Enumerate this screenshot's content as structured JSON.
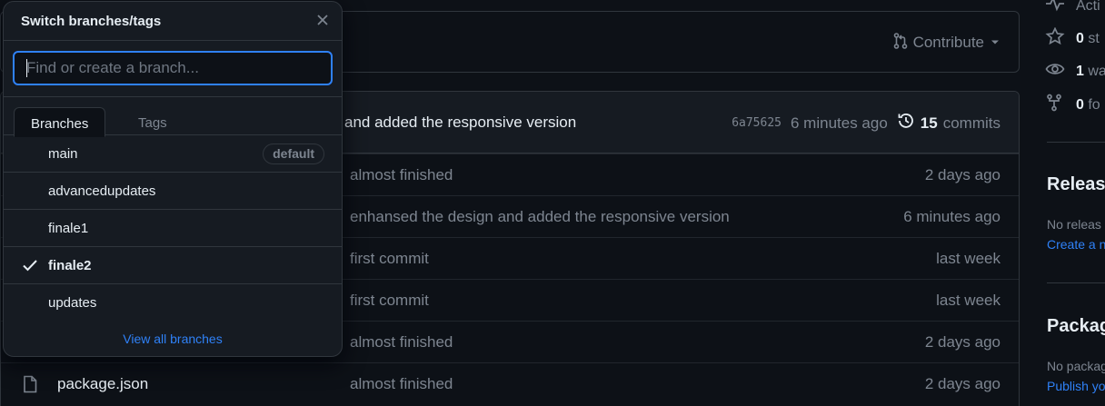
{
  "contribute": {
    "label": "Contribute",
    "icon": "git-pull-request-icon"
  },
  "latest_commit": {
    "message": "and added the responsive version",
    "sha": "6a75625",
    "age": "6 minutes ago",
    "commits_count": "15",
    "commits_label": "commits"
  },
  "files": [
    {
      "name": "",
      "message": "almost finished",
      "age": "2 days ago"
    },
    {
      "name": "",
      "message": "enhansed the design and added the responsive version",
      "age": "6 minutes ago"
    },
    {
      "name": "",
      "message": "first commit",
      "age": "last week"
    },
    {
      "name": "",
      "message": "first commit",
      "age": "last week"
    },
    {
      "name": "",
      "message": "almost finished",
      "age": "2 days ago"
    },
    {
      "name": "package.json",
      "message": "almost finished",
      "age": "2 days ago"
    }
  ],
  "sidebar": {
    "activity": "Acti",
    "stars_count": "0",
    "stars_label": "st",
    "watching_count": "1",
    "watching_label": "wa",
    "forks_count": "0",
    "forks_label": "fo",
    "releases_title": "Release",
    "releases_text": "No releas",
    "releases_link": "Create a n",
    "packages_title": "Packag",
    "packages_text": "No packag",
    "packages_link": "Publish yo"
  },
  "dropdown": {
    "title": "Switch branches/tags",
    "filter_placeholder": "Find or create a branch...",
    "tabs": {
      "branches": "Branches",
      "tags": "Tags"
    },
    "branches": [
      {
        "name": "main",
        "badge": "default",
        "selected": false
      },
      {
        "name": "advancedupdates",
        "selected": false
      },
      {
        "name": "finale1",
        "selected": false
      },
      {
        "name": "finale2",
        "selected": true
      },
      {
        "name": "updates",
        "selected": false
      }
    ],
    "view_all": "View all branches"
  },
  "colors": {
    "background": "#0d1117",
    "panel": "#161b22",
    "border": "#30363d",
    "text": "#e6edf3",
    "muted": "#7d8590",
    "accent": "#2f81f7"
  }
}
